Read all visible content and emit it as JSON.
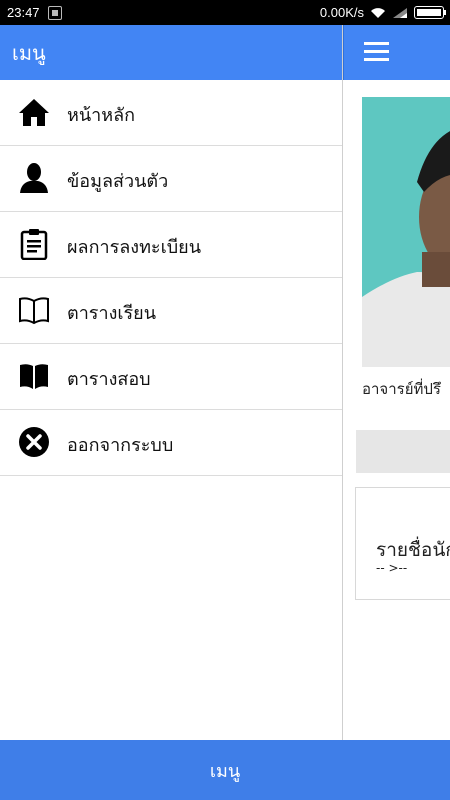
{
  "status_bar": {
    "time": "23:47",
    "network_speed": "0.00K/s",
    "battery_level": 1.0
  },
  "drawer": {
    "title": "เมนู",
    "items": [
      {
        "label": "หน้าหลัก",
        "icon": "home-icon"
      },
      {
        "label": "ข้อมูลส่วนตัว",
        "icon": "person-icon"
      },
      {
        "label": "ผลการลงทะเบียน",
        "icon": "clipboard-icon"
      },
      {
        "label": "ตารางเรียน",
        "icon": "open-book-outline-icon"
      },
      {
        "label": "ตารางสอบ",
        "icon": "open-book-filled-icon"
      },
      {
        "label": "ออกจากระบบ",
        "icon": "close-circle-icon"
      }
    ]
  },
  "main": {
    "advisor_label": "อาจารย์ที่ปรึ",
    "card_title": "รายชื่อนัก",
    "card_subtitle": "-- >--"
  },
  "bottom_bar": {
    "label": "เมนู"
  },
  "colors": {
    "primary": "#4285f4",
    "bottom_bar": "#3f7ee8",
    "photo_bg": "#5ec7c1"
  }
}
